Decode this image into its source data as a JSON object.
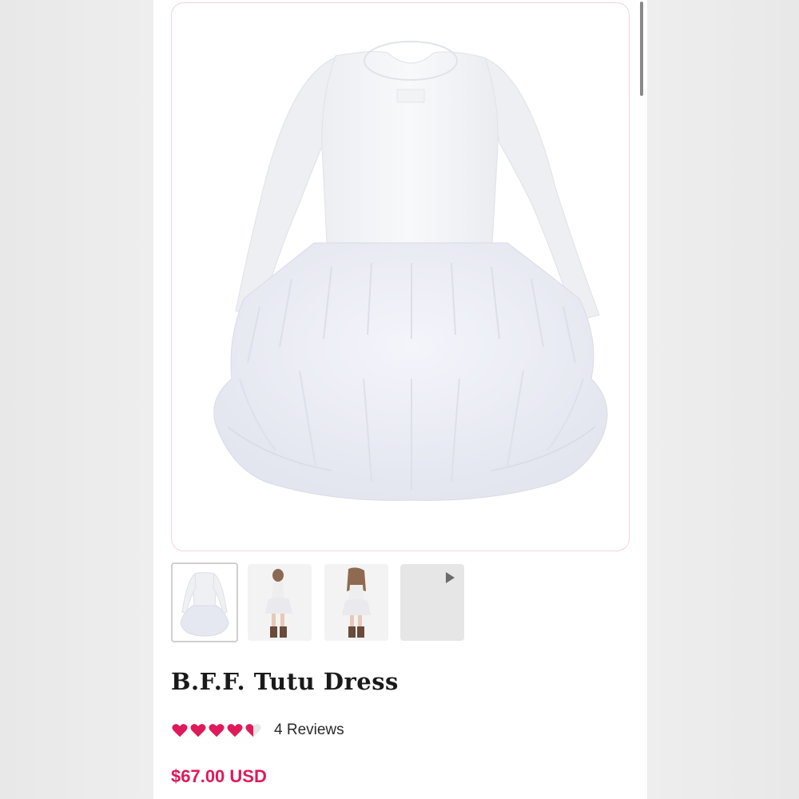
{
  "product": {
    "title": "B.F.F. Tutu Dress",
    "rating_value": 4.5,
    "rating_max": 5,
    "reviews_label": "4 Reviews",
    "price": "$67.00 USD"
  },
  "gallery": {
    "selected_index": 0,
    "thumbnail_count": 4,
    "last_thumbnail_icon": "play-icon"
  },
  "colors": {
    "accent": "#e0195a",
    "card_border": "#f2d4dc"
  }
}
